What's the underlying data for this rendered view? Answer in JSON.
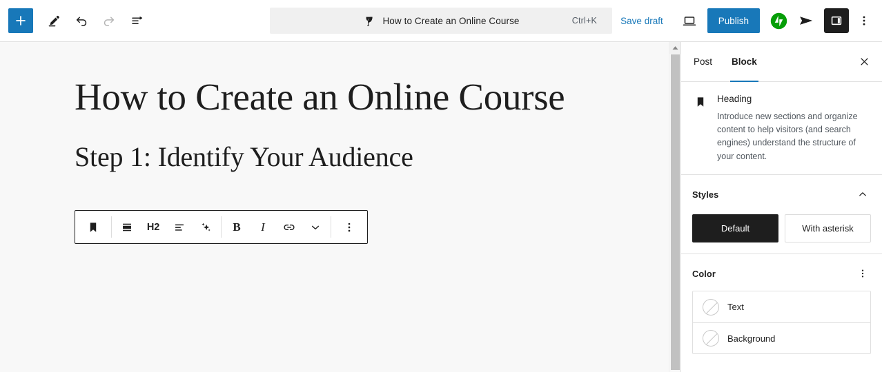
{
  "header": {
    "inserter_label": "Toggle block inserter",
    "tools_label": "Tools",
    "undo_label": "Undo",
    "redo_label": "Redo",
    "list_view_label": "Document Overview",
    "command_bar": {
      "title": "How to Create an Online Course",
      "shortcut": "Ctrl+K",
      "icon": "post-leaf-icon"
    },
    "save_draft_label": "Save draft",
    "preview_label": "Preview",
    "publish_label": "Publish",
    "jetpack_label": "Jetpack",
    "publicize_label": "Share post",
    "settings_toggle_label": "Settings",
    "options_label": "Options",
    "accent_color": "#1878b9",
    "dark_color": "#1e1e1e"
  },
  "editor": {
    "post_title": "How to Create an Online Course",
    "heading_block_text": "Step 1: Identify Your Audience",
    "canvas_background": "#f8f8f8"
  },
  "block_toolbar": {
    "block_type_label": "Heading",
    "block_type_icon": "heading-bookmark-icon",
    "move_label": "Drag",
    "move_icon": "block-style-icon",
    "level_label": "H2",
    "align_label": "Align text",
    "align_icon": "align-text-icon",
    "ai_label": "AI Assistant",
    "ai_icon": "sparkles-icon",
    "bold_label": "B",
    "italic_label": "I",
    "link_label": "Link",
    "link_icon": "link-icon",
    "more_formatting_label": "More",
    "more_formatting_icon": "chevron-down-icon",
    "options_label": "Options",
    "options_icon": "vertical-ellipsis-icon"
  },
  "sidebar": {
    "tabs": [
      {
        "label": "Post",
        "active": false
      },
      {
        "label": "Block",
        "active": true
      }
    ],
    "close_label": "Close Settings",
    "block_info": {
      "icon": "heading-bookmark-icon",
      "title": "Heading",
      "description": "Introduce new sections and organize content to help visitors (and search engines) understand the structure of your content."
    },
    "styles": {
      "title": "Styles",
      "collapse_icon": "chevron-up-icon",
      "options": [
        {
          "label": "Default",
          "selected": true
        },
        {
          "label": "With asterisk",
          "selected": false
        }
      ]
    },
    "color": {
      "title": "Color",
      "menu_icon": "vertical-ellipsis-icon",
      "rows": [
        {
          "label": "Text",
          "swatch": "none"
        },
        {
          "label": "Background",
          "swatch": "none"
        }
      ]
    }
  }
}
